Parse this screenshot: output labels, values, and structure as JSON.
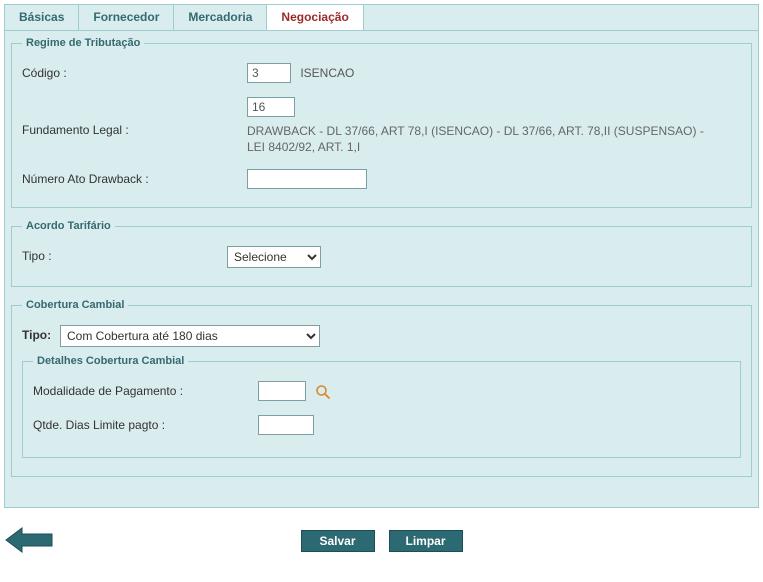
{
  "tabs": {
    "basicas": "Básicas",
    "fornecedor": "Fornecedor",
    "mercadoria": "Mercadoria",
    "negociacao": "Negociação"
  },
  "regime": {
    "legend": "Regime de Tributação",
    "codigo_label": "Código :",
    "codigo_value": "3",
    "codigo_text": "ISENCAO",
    "fund_label": "Fundamento Legal :",
    "fund_code": "16",
    "fund_text": "DRAWBACK - DL 37/66, ART 78,I (ISENCAO) - DL 37/66, ART. 78,II (SUSPENSAO) - LEI 8402/92, ART. 1,I",
    "drawback_label": "Número Ato Drawback :",
    "drawback_value": ""
  },
  "acordo": {
    "legend": "Acordo Tarifário",
    "tipo_label": "Tipo :",
    "tipo_selected": "Selecione"
  },
  "cobertura": {
    "legend": "Cobertura Cambial",
    "tipo_label": "Tipo:",
    "tipo_selected": "Com Cobertura até 180 dias",
    "detalhes_legend": "Detalhes Cobertura Cambial",
    "modalidade_label": "Modalidade de Pagamento :",
    "modalidade_value": "",
    "dias_label": "Qtde. Dias Limite pagto :",
    "dias_value": ""
  },
  "actions": {
    "salvar": "Salvar",
    "limpar": "Limpar"
  }
}
